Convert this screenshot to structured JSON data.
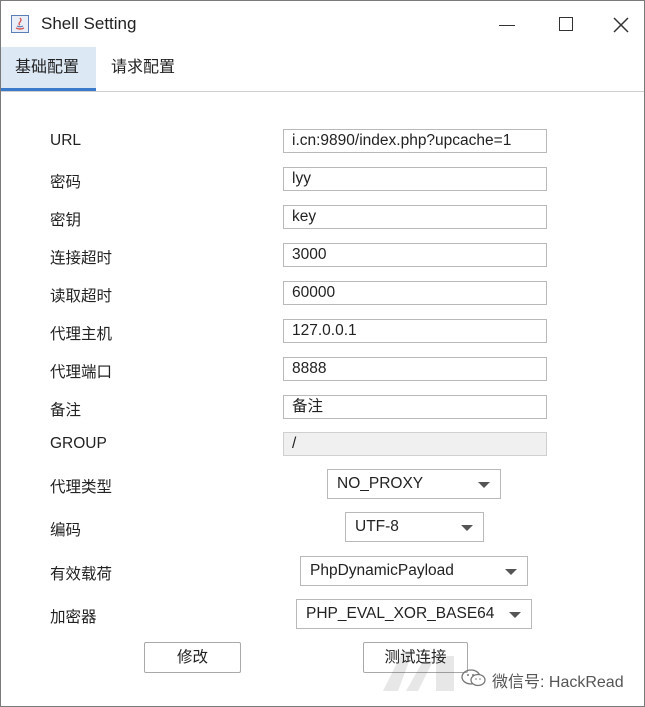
{
  "window": {
    "title": "Shell Setting"
  },
  "tabs": [
    {
      "label": "基础配置"
    },
    {
      "label": "请求配置"
    }
  ],
  "form": {
    "url": {
      "label": "URL",
      "value": "i.cn:9890/index.php?upcache=1"
    },
    "password": {
      "label": "密码",
      "value": "lyy"
    },
    "key": {
      "label": "密钥",
      "value": "key"
    },
    "connect_timeout": {
      "label": "连接超时",
      "value": "3000"
    },
    "read_timeout": {
      "label": "读取超时",
      "value": "60000"
    },
    "proxy_host": {
      "label": "代理主机",
      "value": "127.0.0.1"
    },
    "proxy_port": {
      "label": "代理端口",
      "value": "8888"
    },
    "remark": {
      "label": "备注",
      "value": "备注"
    },
    "group": {
      "label": "GROUP",
      "value": "/"
    },
    "proxy_type": {
      "label": "代理类型",
      "value": "NO_PROXY"
    },
    "encoding": {
      "label": "编码",
      "value": "UTF-8"
    },
    "payload": {
      "label": "有效载荷",
      "value": "PhpDynamicPayload"
    },
    "cryption": {
      "label": "加密器",
      "value": "PHP_EVAL_XOR_BASE64"
    }
  },
  "buttons": {
    "modify": "修改",
    "test": "测试连接"
  },
  "watermark": {
    "text": "微信号: HackRead"
  }
}
